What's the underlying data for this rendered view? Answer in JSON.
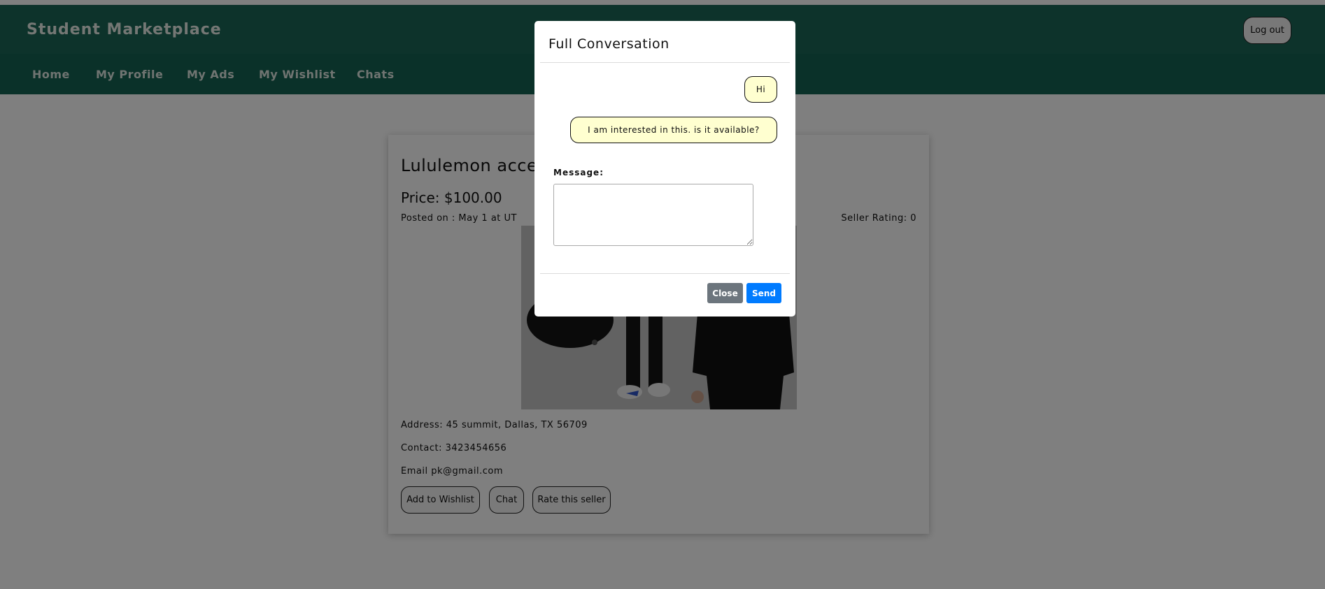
{
  "app": {
    "brand": "Student Marketplace",
    "logout_label": "Log out"
  },
  "nav": {
    "items": [
      "Home",
      "My Profile",
      "My Ads",
      "My Wishlist",
      "Chats"
    ]
  },
  "listing": {
    "title": "Lululemon acces",
    "price": "Price: $100.00",
    "posted": "Posted on : May 1  at UT",
    "seller_rating": "Seller Rating: 0",
    "address": "Address:  45 summit, Dallas, TX 56709",
    "contact": "Contact:  3423454656",
    "email": "Email  pk@gmail.com",
    "buttons": {
      "wishlist": "Add to Wishlist",
      "chat": "Chat",
      "rate": "Rate this seller"
    }
  },
  "modal": {
    "title": "Full Conversation",
    "messages": [
      "Hi",
      "I am interested in this. is it available?"
    ],
    "message_label": "Message:",
    "message_value": "",
    "close_label": "Close",
    "send_label": "Send"
  },
  "colors": {
    "header_bg": "#1a6656",
    "nav_bg": "#156252",
    "bubble_bg": "#ffffd0",
    "close_button": "#6c757d",
    "send_button": "#007bff"
  }
}
